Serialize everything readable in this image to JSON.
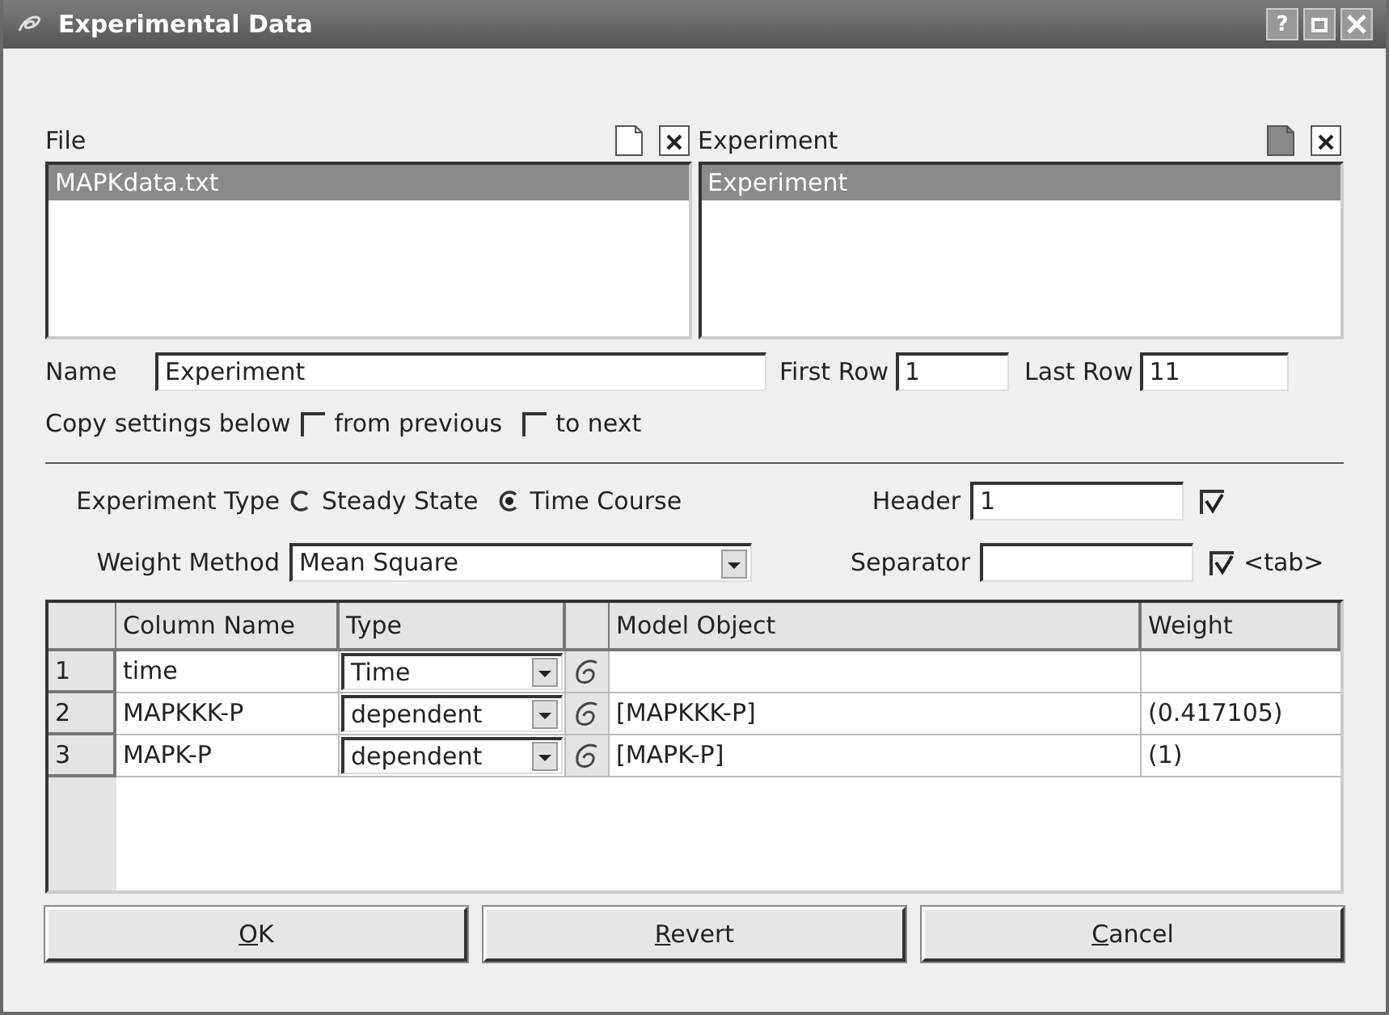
{
  "window": {
    "title": "Experimental Data",
    "help_button": "?"
  },
  "file_panel": {
    "label": "File",
    "items": [
      {
        "text": "MAPKdata.txt",
        "selected": true
      }
    ]
  },
  "experiment_panel": {
    "label": "Experiment",
    "items": [
      {
        "text": "Experiment",
        "selected": true
      }
    ]
  },
  "name": {
    "label": "Name",
    "value": "Experiment"
  },
  "first_row": {
    "label": "First Row",
    "value": "1"
  },
  "last_row": {
    "label": "Last Row",
    "value": "11"
  },
  "copy_settings": {
    "label": "Copy settings below",
    "options": [
      {
        "label": "from previous",
        "checked": false
      },
      {
        "label": "to next",
        "checked": false
      }
    ]
  },
  "experiment_type": {
    "label": "Experiment Type",
    "options": [
      {
        "label": "Steady State",
        "selected": false
      },
      {
        "label": "Time Course",
        "selected": true
      }
    ]
  },
  "header": {
    "label": "Header",
    "value": "1",
    "checked": true
  },
  "weight_method": {
    "label": "Weight Method",
    "value": "Mean Square"
  },
  "separator": {
    "label": "Separator",
    "checked": true,
    "check_label": "<tab>"
  },
  "table": {
    "columns": [
      "Column Name",
      "Type",
      "Model Object",
      "Weight"
    ],
    "rows": [
      {
        "number": "1",
        "column_name": "time",
        "type": "Time"
      },
      {
        "number": "2",
        "column_name": "MAPKKK-P",
        "type": "dependent",
        "model_object": "[MAPKKK-P]",
        "weight": "(0.417105)"
      },
      {
        "number": "3",
        "column_name": "MAPK-P",
        "type": "dependent",
        "model_object": "[MAPK-P]",
        "weight": "(1)"
      }
    ]
  },
  "buttons": [
    {
      "mnemonic": "O",
      "rest": "K"
    },
    {
      "mnemonic": "R",
      "rest": "evert"
    },
    {
      "mnemonic": "C",
      "rest": "ancel"
    }
  ]
}
